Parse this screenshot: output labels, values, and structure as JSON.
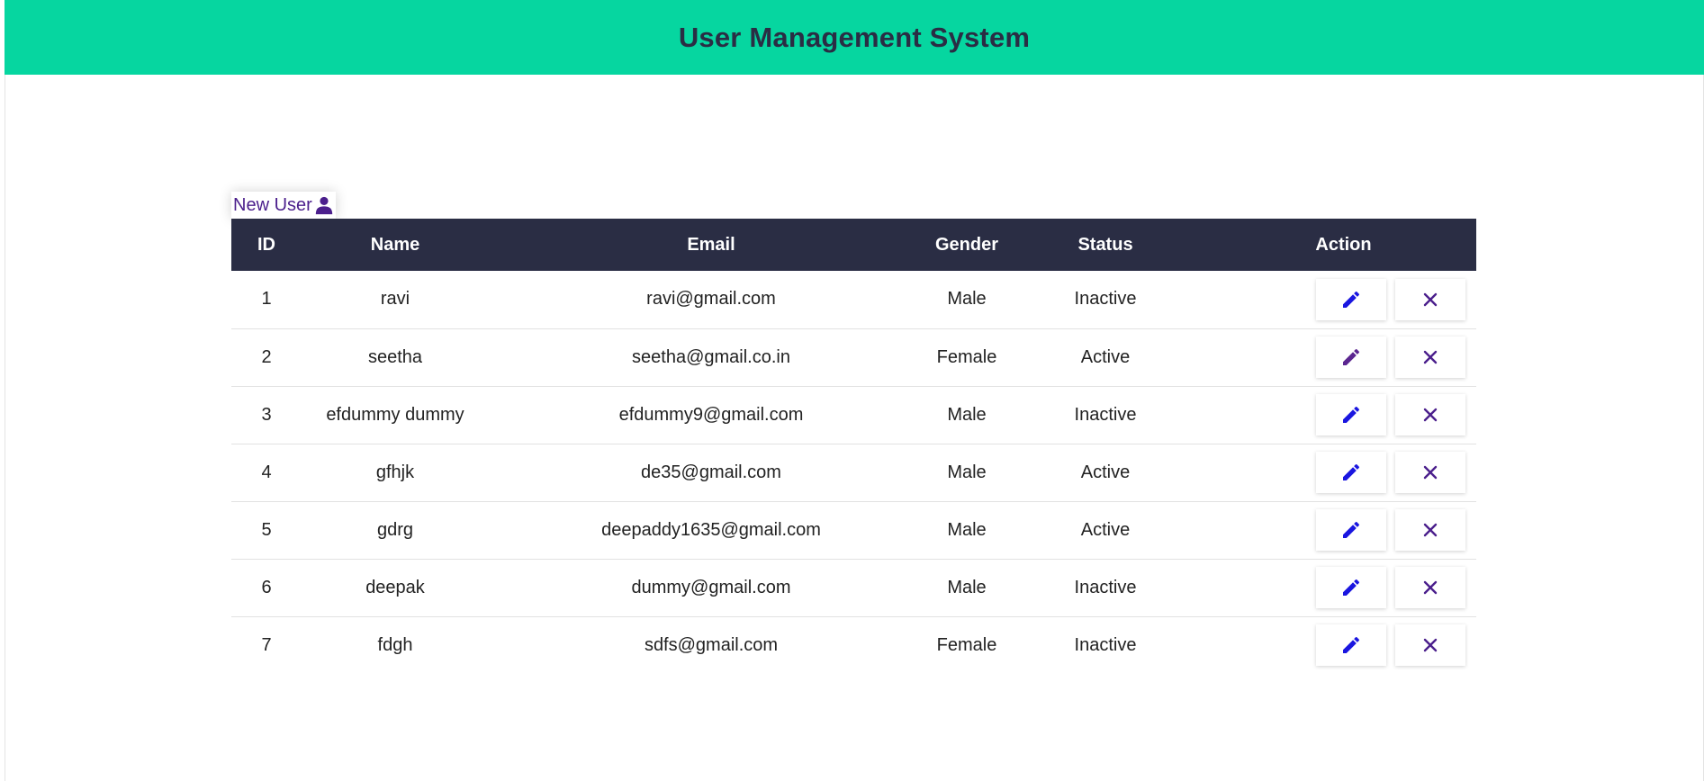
{
  "header": {
    "title": "User Management System"
  },
  "toolbar": {
    "new_user_label": "New User"
  },
  "table": {
    "columns": [
      "ID",
      "Name",
      "Email",
      "Gender",
      "Status",
      "Action"
    ],
    "rows": [
      {
        "id": "1",
        "name": "ravi",
        "email": "ravi@gmail.com",
        "gender": "Male",
        "status": "Inactive"
      },
      {
        "id": "2",
        "name": "seetha",
        "email": "seetha@gmail.co.in",
        "gender": "Female",
        "status": "Active"
      },
      {
        "id": "3",
        "name": "efdummy dummy",
        "email": "efdummy9@gmail.com",
        "gender": "Male",
        "status": "Inactive"
      },
      {
        "id": "4",
        "name": "gfhjk",
        "email": "de35@gmail.com",
        "gender": "Male",
        "status": "Active"
      },
      {
        "id": "5",
        "name": "gdrg",
        "email": "deepaddy1635@gmail.com",
        "gender": "Male",
        "status": "Active"
      },
      {
        "id": "6",
        "name": "deepak",
        "email": "dummy@gmail.com",
        "gender": "Male",
        "status": "Inactive"
      },
      {
        "id": "7",
        "name": "fdgh",
        "email": "sdfs@gmail.com",
        "gender": "Female",
        "status": "Inactive"
      }
    ]
  },
  "icons": {
    "edit": "pencil-icon",
    "delete": "close-icon",
    "new_user": "user-icon"
  },
  "colors": {
    "header_bg": "#06d6a0",
    "table_header_bg": "#2a2d44",
    "edit_icon": "#1a16e0",
    "edit_icon_alt": "#5b2690",
    "delete_icon": "#4b1f8c",
    "new_user_text": "#4b1f8c"
  }
}
